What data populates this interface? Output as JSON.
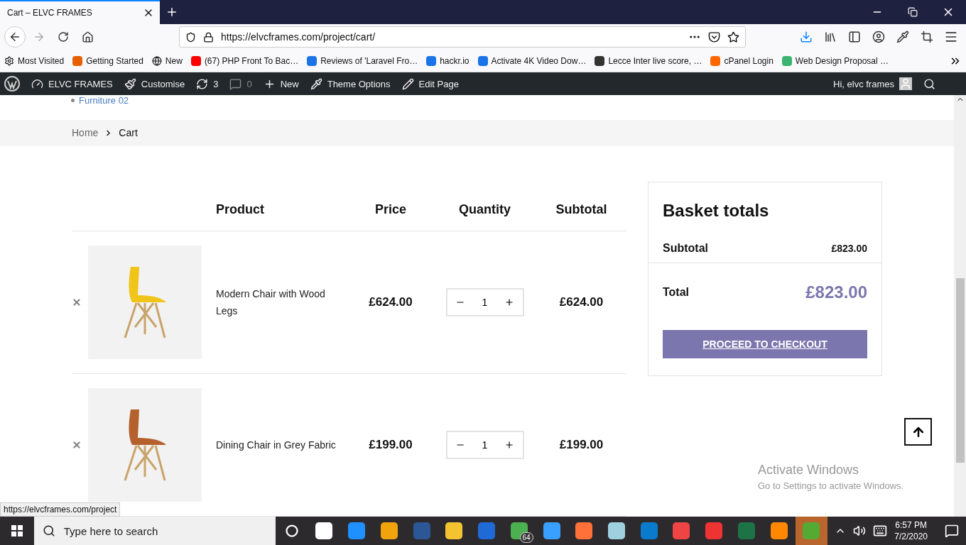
{
  "browser": {
    "tabs": [
      {
        "title": "Cart – ELVC FRAMES",
        "selected": true
      }
    ],
    "url": "https://elvcframes.com/project/cart/",
    "bookmarks": [
      "Most Visited",
      "Getting Started",
      "New",
      "(67) PHP Front To Bac…",
      "Reviews of 'Laravel Fro…",
      "hackr.io",
      "Activate 4K Video Dow…",
      "Lecce Inter live score, …",
      "cPanel Login",
      "Web Design Proposal …"
    ]
  },
  "admin_bar": {
    "items": [
      "ELVC FRAMES",
      "Customise",
      "3",
      "0",
      "New",
      "Theme Options",
      "Edit Page"
    ],
    "greeting": "Hi, elvc frames"
  },
  "page": {
    "menu_link": "Furniture 02",
    "breadcrumb": [
      "Home",
      "Cart"
    ],
    "cart": {
      "columns": [
        "Product",
        "Price",
        "Quantity",
        "Subtotal"
      ],
      "rows": [
        {
          "name": "Modern Chair with Wood Legs",
          "price": "£624.00",
          "quantity": "1",
          "subtotal": "£624.00"
        },
        {
          "name": "Dining Chair in Grey Fabric",
          "price": "£199.00",
          "quantity": "1",
          "subtotal": "£199.00"
        }
      ]
    },
    "totals": {
      "title": "Basket totals",
      "subtotal_label": "Subtotal",
      "subtotal": "£823.00",
      "total_label": "Total",
      "total": "£823.00",
      "button": "PROCEED TO CHECKOUT"
    }
  },
  "status_url": "https://elvcframes.com/project",
  "activation": {
    "title": "Activate Windows",
    "text": "Go to Settings to activate Windows."
  },
  "taskbar": {
    "search_placeholder": "Type here to search",
    "apps": [
      {
        "selected": false
      },
      {
        "selected": false
      },
      {
        "selected": false
      },
      {
        "selected": false
      },
      {
        "selected": false
      },
      {
        "selected": false
      },
      {
        "selected": false
      },
      {
        "selected": false,
        "badge": "64"
      },
      {
        "selected": false
      },
      {
        "selected": false
      },
      {
        "selected": false
      },
      {
        "selected": false
      },
      {
        "selected": false
      },
      {
        "selected": false
      },
      {
        "selected": false
      },
      {
        "selected": false
      },
      {
        "selected": true
      }
    ],
    "time": "6:57 PM",
    "date": "7/2/2020"
  }
}
